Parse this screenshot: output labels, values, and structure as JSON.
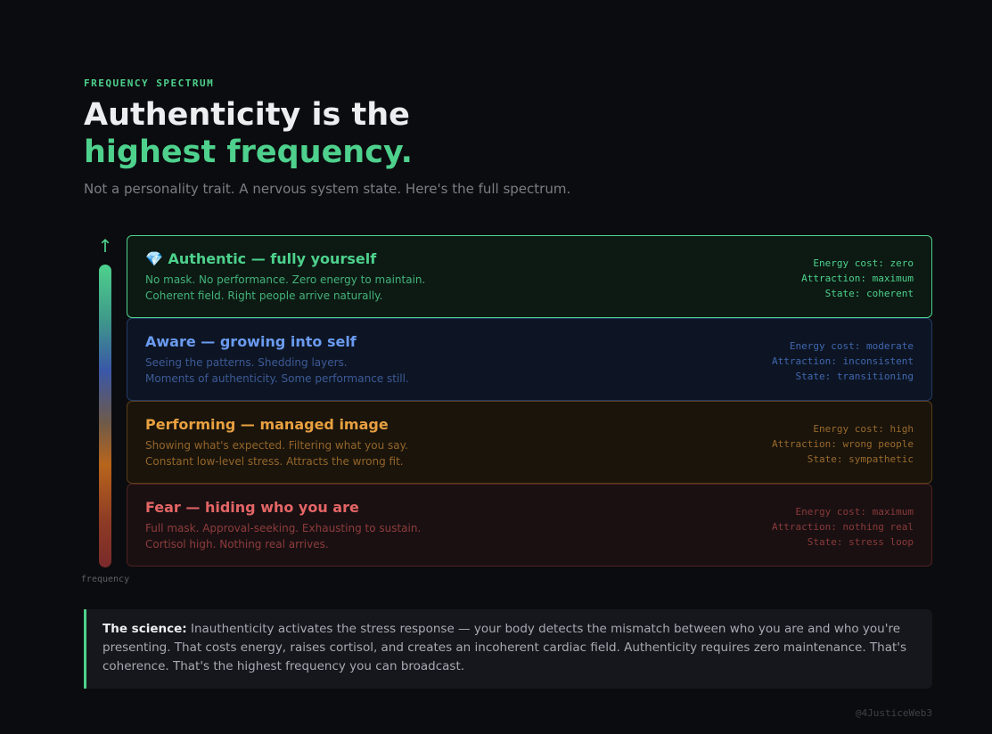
{
  "eyebrow": "FREQUENCY SPECTRUM",
  "title": {
    "line1": "Authenticity is the",
    "line2": "highest frequency."
  },
  "subtitle": "Not a personality trait. A nervous system state. Here's the full spectrum.",
  "axis": {
    "arrow": "↑",
    "label": "frequency"
  },
  "tiers": [
    {
      "name": "💎 Authentic — fully yourself",
      "desc": [
        "No mask. No performance. Zero energy to maintain.",
        "Coherent field. Right people arrive naturally."
      ],
      "meta": [
        "Energy cost: zero",
        "Attraction: maximum",
        "State: coherent"
      ],
      "color": "#4ed18d"
    },
    {
      "name": "Aware — growing into self",
      "desc": [
        "Seeing the patterns. Shedding layers.",
        "Moments of authenticity. Some performance still."
      ],
      "meta": [
        "Energy cost: moderate",
        "Attraction: inconsistent",
        "State: transitioning"
      ],
      "color": "#6a9bf0"
    },
    {
      "name": "Performing — managed image",
      "desc": [
        "Showing what's expected. Filtering what you say.",
        "Constant low-level stress. Attracts the wrong fit."
      ],
      "meta": [
        "Energy cost: high",
        "Attraction: wrong people",
        "State: sympathetic"
      ],
      "color": "#e8a040"
    },
    {
      "name": "Fear — hiding who you are",
      "desc": [
        "Full mask. Approval-seeking. Exhausting to sustain.",
        "Cortisol high. Nothing real arrives."
      ],
      "meta": [
        "Energy cost: maximum",
        "Attraction: nothing real",
        "State: stress loop"
      ],
      "color": "#e46565"
    }
  ],
  "science": {
    "label": "The science:",
    "text": " Inauthenticity activates the stress response — your body detects the mismatch between who you are and who you're presenting. That costs energy, raises cortisol, and creates an incoherent cardiac field. Authenticity requires zero maintenance. That's coherence. That's the highest frequency you can broadcast."
  },
  "handle": "@4JusticeWeb3"
}
